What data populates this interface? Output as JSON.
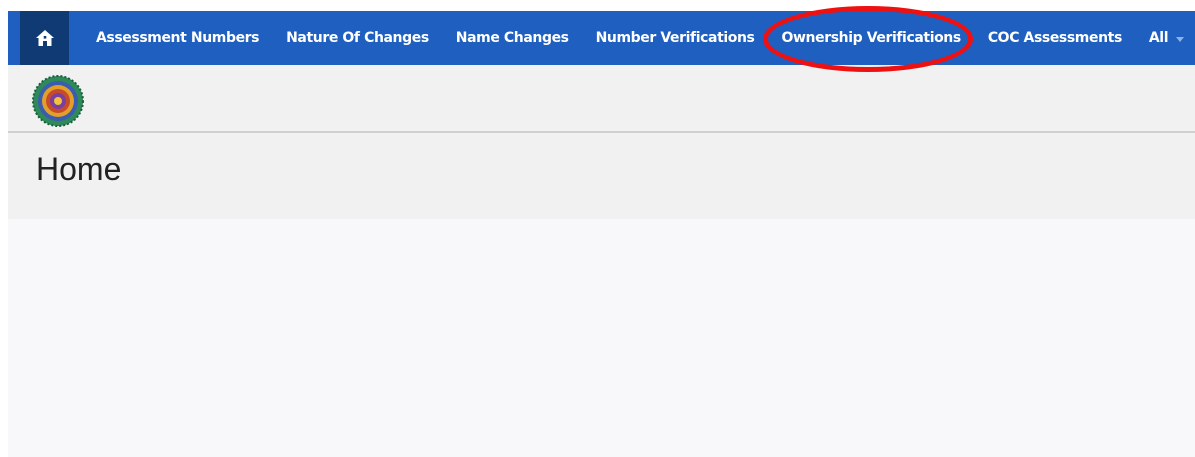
{
  "nav": {
    "home_icon": "home-icon",
    "items": [
      {
        "label": "Assessment Numbers"
      },
      {
        "label": "Nature Of Changes"
      },
      {
        "label": "Name Changes"
      },
      {
        "label": "Number Verifications"
      },
      {
        "label": "Ownership Verifications"
      },
      {
        "label": "COC Assessments"
      }
    ],
    "all_label": "All"
  },
  "header": {
    "logo_icon": "emblem-logo"
  },
  "page": {
    "title": "Home"
  },
  "annotation": {
    "shape": "ellipse",
    "color": "#ee1111",
    "target": "Ownership Verifications"
  },
  "colors": {
    "navbar": "#1f5fbf",
    "home_active": "#103a73",
    "page_bg": "#f1f1f1"
  }
}
